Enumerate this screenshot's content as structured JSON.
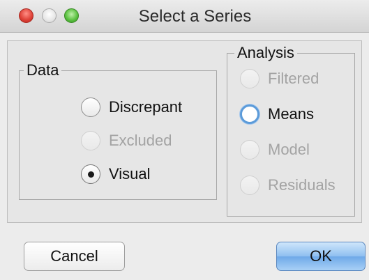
{
  "window": {
    "title": "Select a Series"
  },
  "data_group": {
    "legend": "Data",
    "options": [
      {
        "label": "Discrepant",
        "enabled": true,
        "checked": false
      },
      {
        "label": "Excluded",
        "enabled": false,
        "checked": false
      },
      {
        "label": "Visual",
        "enabled": true,
        "checked": true
      }
    ]
  },
  "analysis_group": {
    "legend": "Analysis",
    "options": [
      {
        "label": "Filtered",
        "enabled": false,
        "checked": false
      },
      {
        "label": "Means",
        "enabled": true,
        "checked": false,
        "focused": true
      },
      {
        "label": "Model",
        "enabled": false,
        "checked": false
      },
      {
        "label": "Residuals",
        "enabled": false,
        "checked": false
      }
    ]
  },
  "buttons": {
    "cancel_label": "Cancel",
    "ok_label": "OK"
  },
  "colors": {
    "focus_ring": "#5c9bd9",
    "default_button": "#8fbff0",
    "disabled_text": "#a3a3a3"
  }
}
